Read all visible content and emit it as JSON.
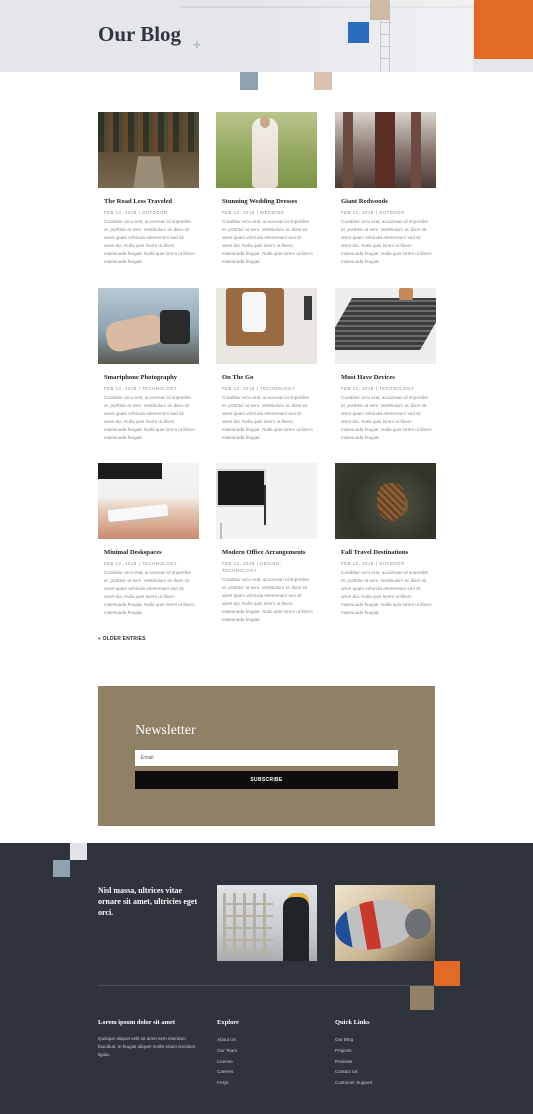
{
  "header": {
    "title": "Our Blog"
  },
  "colors": {
    "accent_orange": "#e06a26",
    "accent_blue": "#2a6bbd",
    "accent_grey_blue": "#8ea3ad",
    "accent_beige": "#d9c2ad",
    "newsletter_bg": "#8f8066",
    "footer_bg": "#2e333c"
  },
  "posts": [
    {
      "title": "The Road Less Traveled",
      "meta": "Feb 12, 2018 | Outdoor",
      "excerpt": "Curabitur arcu erat, accumsan id imperdiet et, porttitor at sem. Vestibulum ac diam sit amet quam vehicula elementum sed sit amet dui. Nulla quis lorem ut libero malesuada feugiat. Nulla quis lorem ut libero malesuada feugiat.",
      "image": "forest-road-photo"
    },
    {
      "title": "Stunning Wedding Dresses",
      "meta": "Feb 12, 2018 | Wedding",
      "excerpt": "Curabitur arcu erat, accumsan id imperdiet et, porttitor at sem. Vestibulum ac diam sit amet quam vehicula elementum sed sit amet dui. Nulla quis lorem ut libero malesuada feugiat. Nulla quis lorem ut libero malesuada feugiat.",
      "image": "wedding-dress-photo"
    },
    {
      "title": "Giant Redwoods",
      "meta": "Feb 12, 2018 | Outdoor",
      "excerpt": "Curabitur arcu erat, accumsan id imperdiet et, porttitor at sem. Vestibulum ac diam sit amet quam vehicula elementum sed sit amet dui. Nulla quis lorem ut libero malesuada feugiat. Nulla quis lorem ut libero malesuada feugiat.",
      "image": "redwood-trees-photo"
    },
    {
      "title": "Smartphone Photography",
      "meta": "Feb 12, 2018 | Technology",
      "excerpt": "Curabitur arcu erat, accumsan id imperdiet et, porttitor at sem. Vestibulum ac diam sit amet quam vehicula elementum sed sit amet dui. Nulla quis lorem ut libero malesuada feugiat. Nulla quis lorem ut libero malesuada feugiat.",
      "image": "smartphone-photo"
    },
    {
      "title": "On The Go",
      "meta": "Feb 12, 2018 | Technology",
      "excerpt": "Curabitur arcu erat, accumsan id imperdiet et, porttitor at sem. Vestibulum ac diam sit amet quam vehicula elementum sed sit amet dui. Nulla quis lorem ut libero malesuada feugiat. Nulla quis lorem ut libero malesuada feugiat.",
      "image": "phone-on-desk-photo"
    },
    {
      "title": "Must Have Devices",
      "meta": "Feb 12, 2018 | Technology",
      "excerpt": "Curabitur arcu erat, accumsan id imperdiet et, porttitor at sem. Vestibulum ac diam sit amet quam vehicula elementum sed sit amet dui. Nulla quis lorem ut libero malesuada feugiat. Nulla quis lorem ut libero malesuada feugiat.",
      "image": "laptop-keyboard-photo"
    },
    {
      "title": "Minimal Deskspaces",
      "meta": "Feb 12, 2018 | Technology",
      "excerpt": "Curabitur arcu erat, accumsan id imperdiet et, porttitor at sem. Vestibulum ac diam sit amet quam vehicula elementum sed sit amet dui. Nulla quis lorem ut libero malesuada feugiat. Nulla quis lorem ut libero malesuada feugiat.",
      "image": "keyboard-desk-photo"
    },
    {
      "title": "Modern Office Arrangements",
      "meta": "Feb 12, 2018 | Design, Technology",
      "excerpt": "Curabitur arcu erat, accumsan id imperdiet et, porttitor at sem. Vestibulum ac diam sit amet quam vehicula elementum sed sit amet dui. Nulla quis lorem ut libero malesuada feugiat. Nulla quis lorem ut libero malesuada feugiat.",
      "image": "office-monitor-photo"
    },
    {
      "title": "Fall Travel Destinations",
      "meta": "Feb 12, 2018 | Outdoor",
      "excerpt": "Curabitur arcu erat, accumsan id imperdiet et, porttitor at sem. Vestibulum ac diam sit amet quam vehicula elementum sed sit amet dui. Nulla quis lorem ut libero malesuada feugiat. Nulla quis lorem ut libero malesuada feugiat.",
      "image": "pinecone-photo"
    }
  ],
  "pagination": {
    "older_label": "« OLDER ENTRIES"
  },
  "newsletter": {
    "title": "Newsletter",
    "email_placeholder": "Email",
    "subscribe_label": "SUBSCRIBE"
  },
  "footer": {
    "quote": "Nisl massa, ultrices vitae ornare sit amet, ultricies eget orci.",
    "images": [
      "construction-worker-photo",
      "cement-mixer-photo"
    ],
    "about": {
      "heading": "Lorem ipsum dolor sit amet",
      "text": "Quisque aliquet velit sit amet sem interdum faucibus. In feugiat aliquet mollis etiam tincidunt ligula."
    },
    "explore": {
      "heading": "Explore",
      "links": [
        "About Us",
        "Our Team",
        "License",
        "Careers",
        "FAQs"
      ]
    },
    "quick_links": {
      "heading": "Quick Links",
      "links": [
        "Our Blog",
        "Projects",
        "Reviews",
        "Contact Us",
        "Customer Support"
      ]
    }
  }
}
